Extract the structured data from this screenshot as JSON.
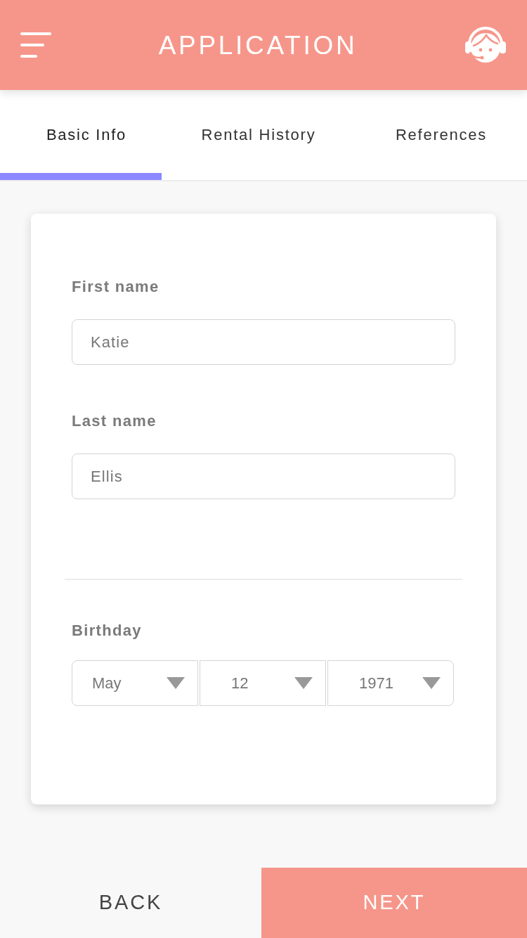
{
  "header": {
    "title": "APPLICATION"
  },
  "tabs": [
    {
      "label": "Basic Info",
      "selected": true
    },
    {
      "label": "Rental History",
      "selected": false
    },
    {
      "label": "References",
      "selected": false
    }
  ],
  "form": {
    "fields": [
      {
        "label": "First name",
        "value": "Katie"
      },
      {
        "label": "Last name",
        "value": "Ellis"
      }
    ],
    "birthday": {
      "label": "Birthday",
      "selects": [
        {
          "value": "May"
        },
        {
          "value": "12"
        },
        {
          "value": "1971"
        }
      ]
    }
  },
  "footer": {
    "buttons": [
      {
        "label": "BACK",
        "kind": "secondary"
      },
      {
        "label": "NEXT",
        "kind": "primary"
      }
    ]
  }
}
